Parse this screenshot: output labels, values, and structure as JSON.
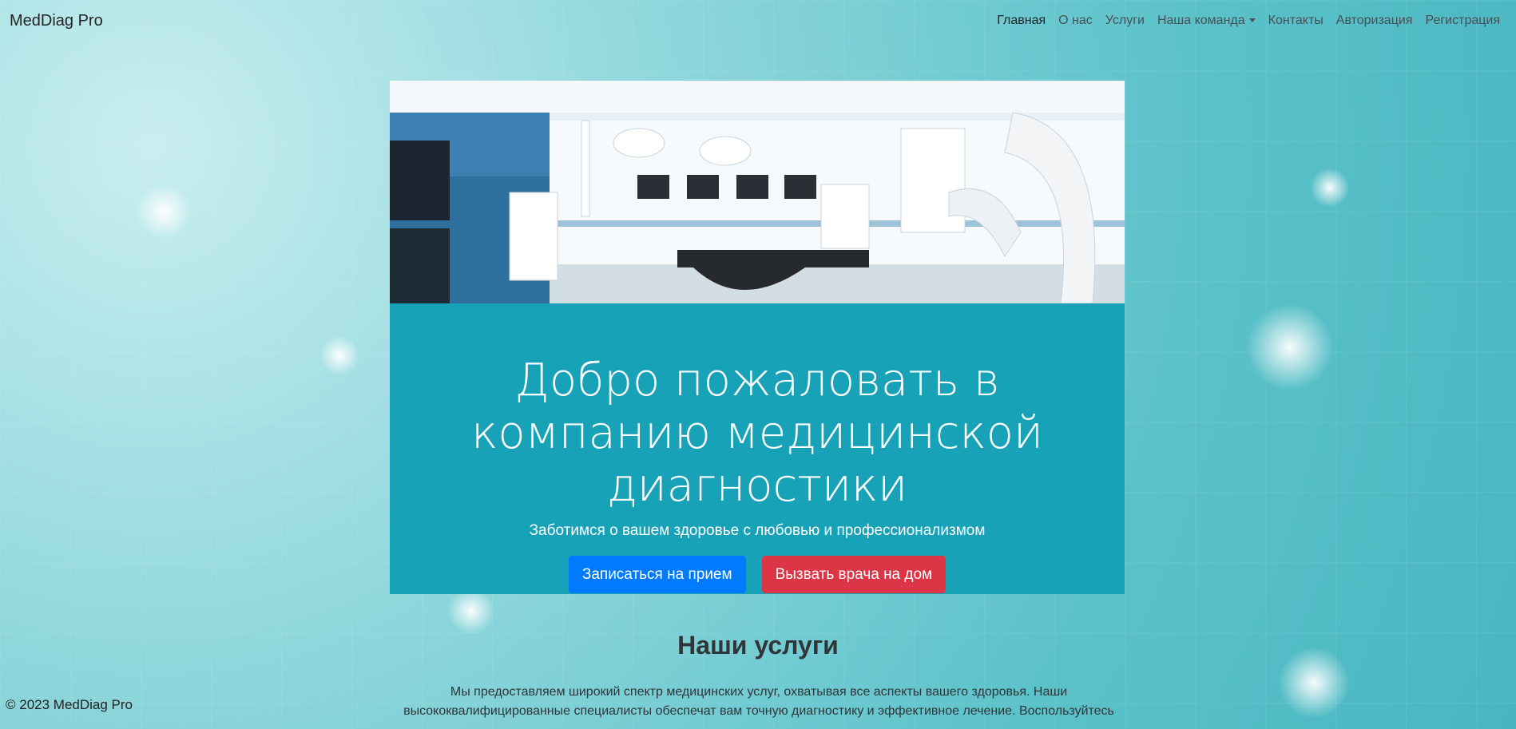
{
  "nav": {
    "brand": "MedDiag Pro",
    "links": [
      {
        "label": "Главная"
      },
      {
        "label": "О нас"
      },
      {
        "label": "Услуги"
      },
      {
        "label": "Наша команда"
      },
      {
        "label": "Контакты"
      },
      {
        "label": "Авторизация"
      },
      {
        "label": "Регистрация"
      }
    ]
  },
  "hero": {
    "title": "Добро пожаловать в компанию медицинской диагностики",
    "subtitle": "Заботимся о вашем здоровье с любовью и профессионализмом",
    "primary_button": "Записаться на прием",
    "secondary_button": "Вызвать врача на дом",
    "colors": {
      "card": "#17a2b8",
      "primary": "#007bff",
      "danger": "#dc3545"
    }
  },
  "services": {
    "title": "Наши услуги",
    "text": "Мы предоставляем широкий спектр медицинских услуг, охватывая все аспекты вашего здоровья. Наши высококвалифицированные специалисты обеспечат вам точную диагностику и эффективное лечение. Воспользуйтесь"
  },
  "footer": {
    "copyright": "© 2023 MedDiag Pro"
  }
}
